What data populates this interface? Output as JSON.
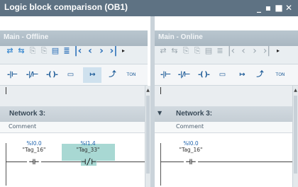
{
  "window": {
    "title": "Logic block comparison (OB1)",
    "controls": [
      "minimize",
      "restore",
      "maximize",
      "close"
    ]
  },
  "panels": {
    "left": {
      "header": "Main - Offline",
      "network_label": "Network 3:",
      "comment": "Comment",
      "contacts": [
        {
          "address": "%I0.0",
          "tag": "\"Tag_16\"",
          "type": "NO"
        },
        {
          "address": "%I1.4",
          "tag": "\"Tag_33\"",
          "type": "NC",
          "highlighted": true
        }
      ]
    },
    "right": {
      "header": "Main - Online",
      "network_label": "Network 3:",
      "comment": "Comment",
      "contacts": [
        {
          "address": "%I0.0",
          "tag": "\"Tag_16\"",
          "type": "NO"
        }
      ]
    }
  },
  "toolbar_ladder": {
    "ton_label": "TON"
  },
  "colors": {
    "title_bar": "#5e7283",
    "panel_header": "#b0bec8",
    "highlight": "#a8d8d3",
    "address_text": "#1f63ad"
  }
}
